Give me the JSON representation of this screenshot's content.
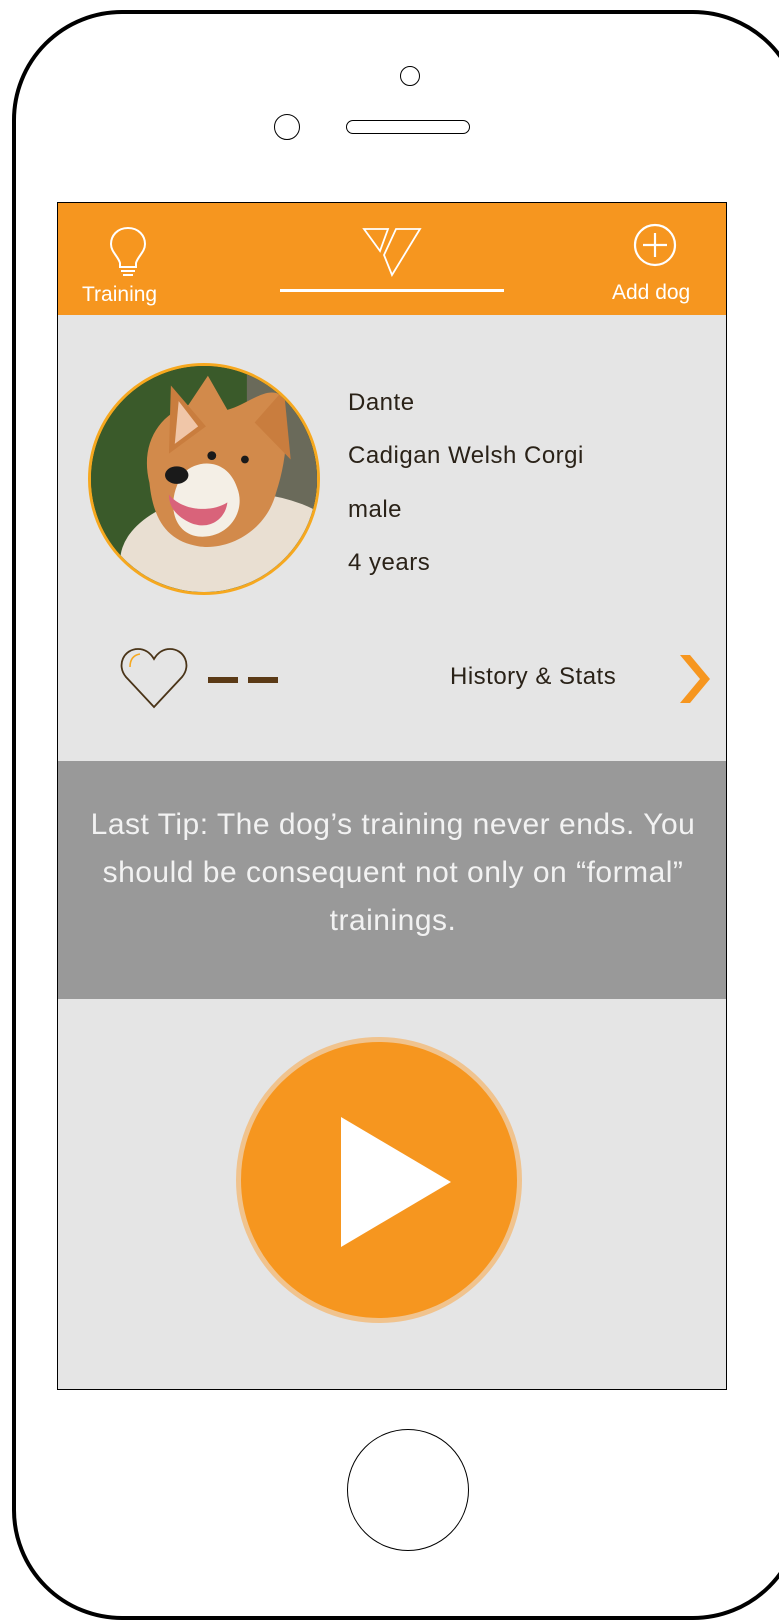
{
  "topbar": {
    "training_label": "Training",
    "add_dog_label": "Add dog",
    "colors": {
      "bar": "#f6961f",
      "text": "#ffffff"
    }
  },
  "dog": {
    "name": "Dante",
    "breed": "Cadigan Welsh Corgi",
    "sex": "male",
    "age": "4 years"
  },
  "stats": {
    "heart_value": "– –",
    "link_label": "History & Stats"
  },
  "tip": {
    "text": "Last Tip: The dog’s training never ends. You should be consequent not only on “formal” trainings."
  },
  "icons": {
    "training": "lightbulb-icon",
    "logo": "triangles-logo-icon",
    "add": "plus-circle-icon",
    "heart": "heart-icon",
    "chevron": "chevron-right-icon",
    "play": "play-icon"
  },
  "colors": {
    "accent": "#f6961f",
    "tip_bg": "#999999",
    "screen_bg": "#e5e5e5",
    "dash": "#5b3a16"
  }
}
